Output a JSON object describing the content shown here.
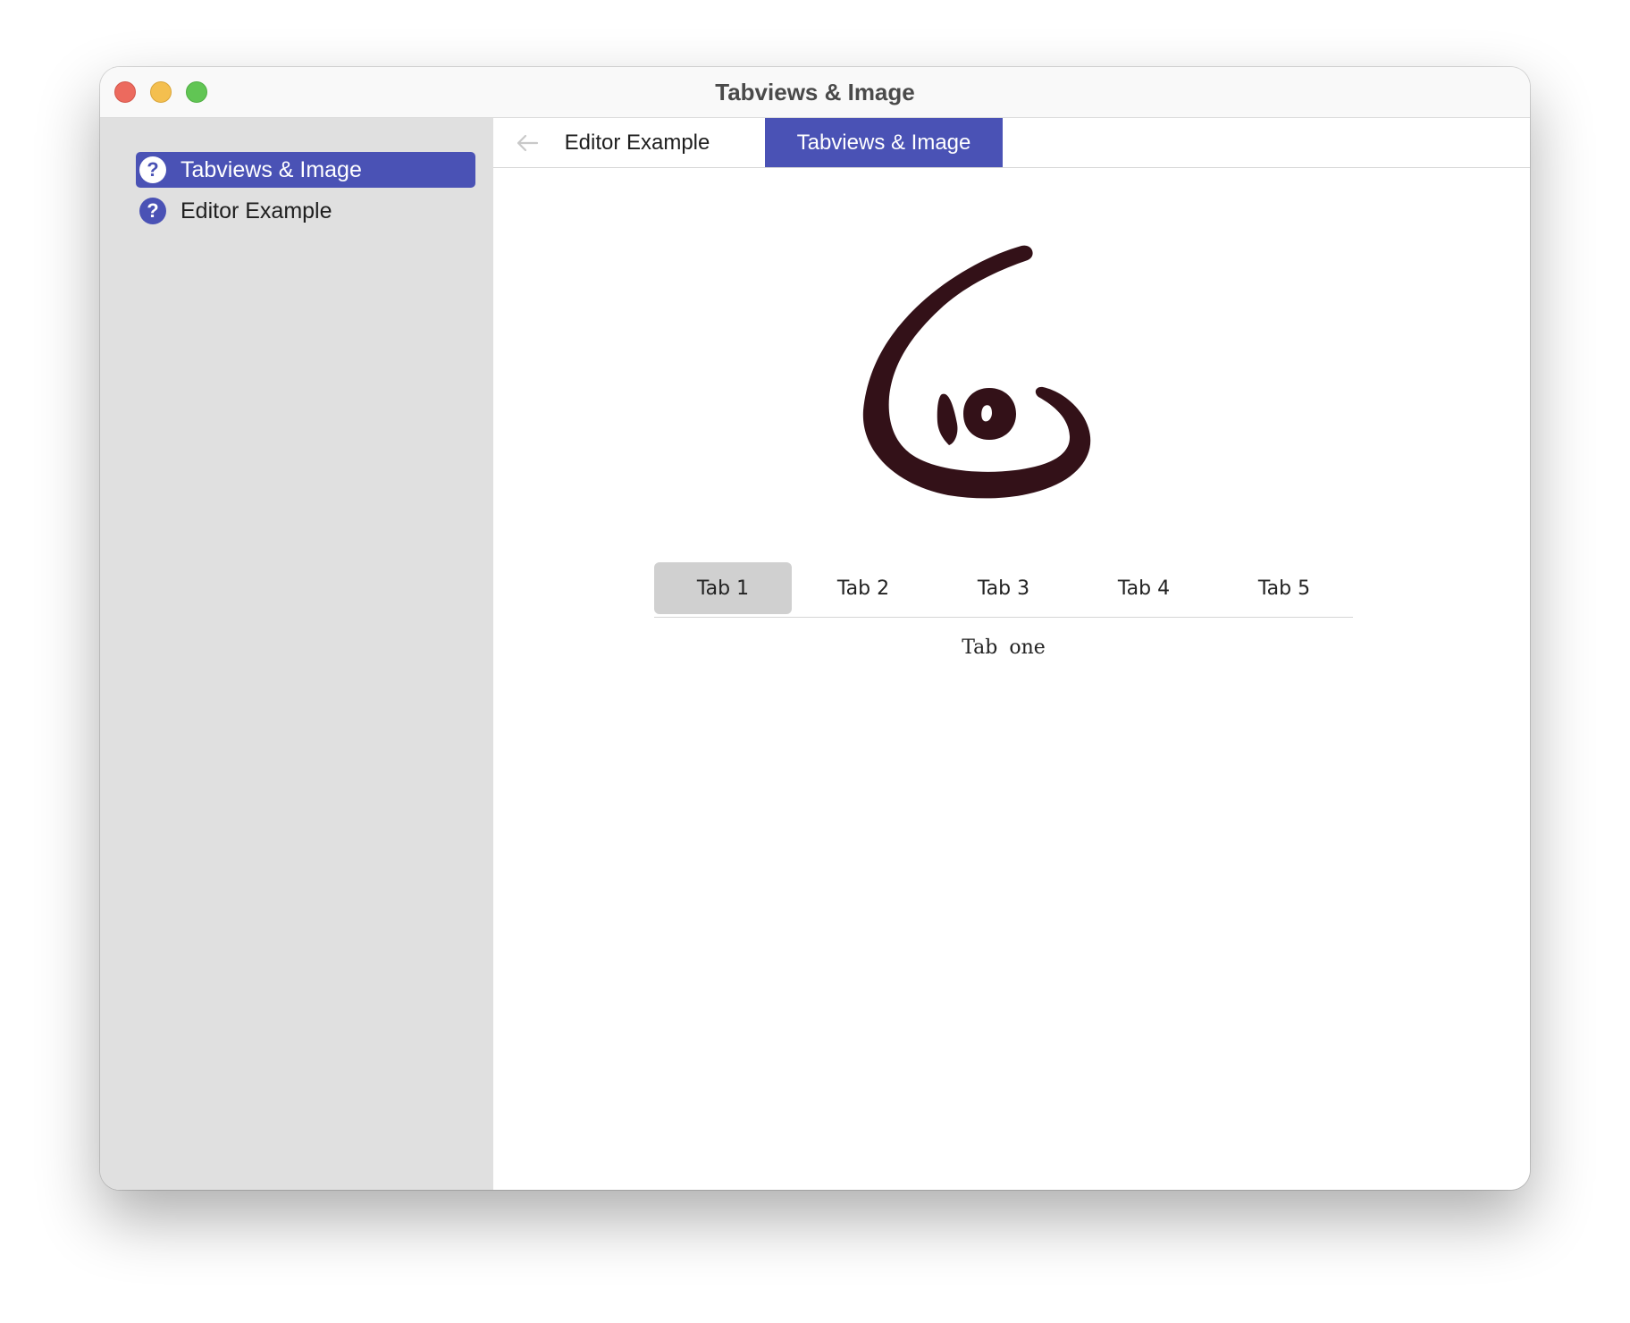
{
  "window": {
    "title": "Tabviews & Image"
  },
  "sidebar": {
    "items": [
      {
        "label": "Tabviews & Image",
        "icon": "question-circle-icon",
        "active": true
      },
      {
        "label": "Editor Example",
        "icon": "question-circle-icon",
        "active": false
      }
    ]
  },
  "topnav": {
    "back_icon": "arrow-left-icon",
    "tabs": [
      {
        "label": "Editor Example",
        "active": false
      },
      {
        "label": "Tabviews & Image",
        "active": true
      }
    ]
  },
  "content": {
    "image": "calligraphy-logo",
    "tabs": [
      {
        "label": "Tab 1",
        "active": true
      },
      {
        "label": "Tab 2",
        "active": false
      },
      {
        "label": "Tab 3",
        "active": false
      },
      {
        "label": "Tab 4",
        "active": false
      },
      {
        "label": "Tab 5",
        "active": false
      }
    ],
    "tab_text": "Tab one"
  },
  "colors": {
    "accent": "#4a52b5",
    "sidebar_bg": "#e0e0e0",
    "logo": "#331118",
    "selected_tab_bg": "#d0d0d0"
  }
}
